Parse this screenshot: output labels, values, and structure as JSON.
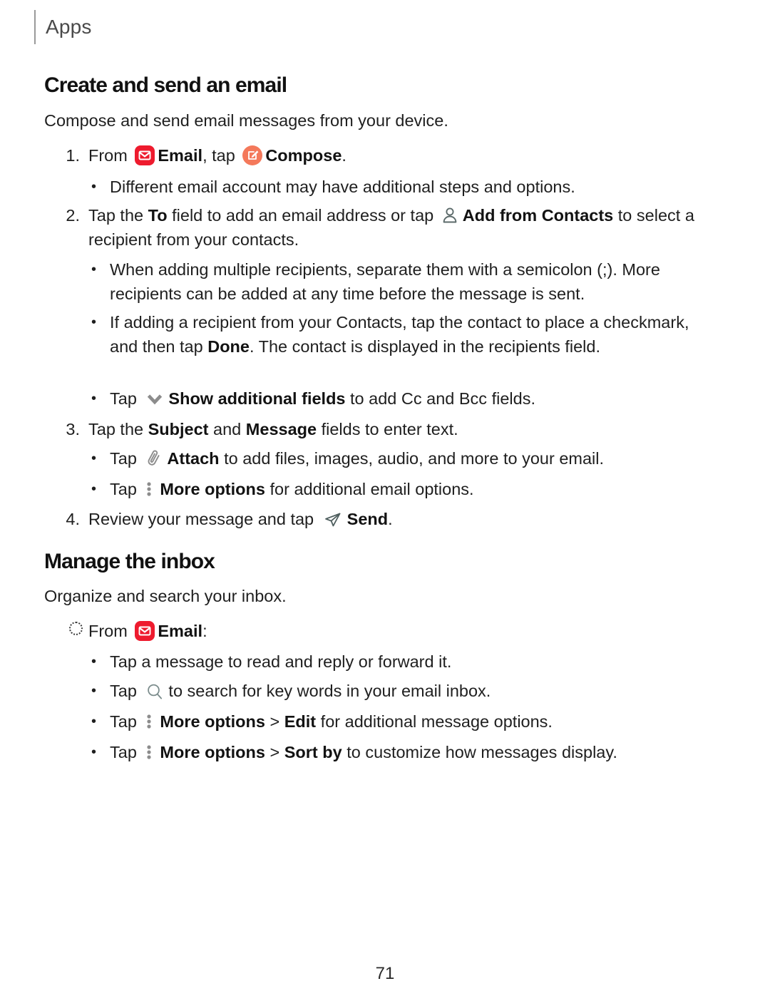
{
  "header": {
    "label": "Apps"
  },
  "sections": [
    {
      "id": "create",
      "title": "Create and send an email",
      "intro": "Compose and send email messages from your device."
    },
    {
      "id": "manage",
      "title": "Manage the inbox",
      "intro": "Organize and search your inbox."
    }
  ],
  "steps": {
    "s1": {
      "marker": "1.",
      "a": "From",
      "b": "Email",
      "c": ", tap",
      "d": "Compose",
      "e": "."
    },
    "s1b1": {
      "dot": "•",
      "text": "Different email account may have additional steps and options."
    },
    "s2": {
      "marker": "2.",
      "a": "Tap the",
      "b": "To",
      "c": "field to add an email address or tap",
      "d": "Add from Contacts",
      "e": "to select a recipient from your contacts."
    },
    "s2b1": {
      "dot": "•",
      "text": "When adding multiple recipients, separate them with a semicolon (;). More recipients can be added at any time before the message is sent."
    },
    "s2b2": {
      "dot": "•",
      "a": "If adding a recipient from your Contacts, tap the contact to place a checkmark, and then tap",
      "b": "Done",
      "c": ". The contact is displayed in the recipients field."
    },
    "s2b3": {
      "dot": "•",
      "a": "Tap",
      "b": "Show additional fields",
      "c": "to add Cc and Bcc fields."
    },
    "s3": {
      "marker": "3.",
      "a": "Tap the",
      "b": "Subject",
      "c": "and",
      "d": "Message",
      "e": "fields to enter text."
    },
    "s3b1": {
      "dot": "•",
      "a": "Tap",
      "b": "Attach",
      "c": "to add files, images, audio, and more to your email."
    },
    "s3b2": {
      "dot": "•",
      "a": "Tap",
      "b": "More options",
      "c": "for additional email options."
    },
    "s4": {
      "marker": "4.",
      "a": "Review your message and tap",
      "b": "Send",
      "c": "."
    },
    "m1": {
      "marker": "dotted-circle",
      "a": "From",
      "b": "Email",
      "c": ":"
    },
    "m1b1": {
      "dot": "•",
      "text": "Tap a message to read and reply or forward it."
    },
    "m1b2": {
      "dot": "•",
      "a": "Tap",
      "b": "to search for key words in your email inbox."
    },
    "m1b3": {
      "dot": "•",
      "a": "Tap",
      "b": "More options",
      "c": ">",
      "d": "Edit",
      "e": "for additional message options."
    },
    "m1b4": {
      "dot": "•",
      "a": "Tap",
      "b": "More options",
      "c": ">",
      "d": "Sort by",
      "e": "to customize how messages display."
    }
  },
  "icons": {
    "email": "email-app-icon",
    "compose": "compose-icon",
    "contacts": "add-from-contacts-icon",
    "chevron": "chevron-down-icon",
    "attach": "attach-paperclip-icon",
    "more": "more-options-icon",
    "send": "send-icon",
    "search": "search-icon"
  },
  "colors": {
    "email_badge": "#EE1B2E",
    "compose_badge": "#F4795B",
    "icon_gray": "#8C8C8C",
    "icon_slate": "#5B6A6A",
    "text": "#1f1f1f",
    "header_text": "#4a4a4a",
    "rule": "#9a9a9a"
  },
  "footer": {
    "page_number": "71"
  }
}
